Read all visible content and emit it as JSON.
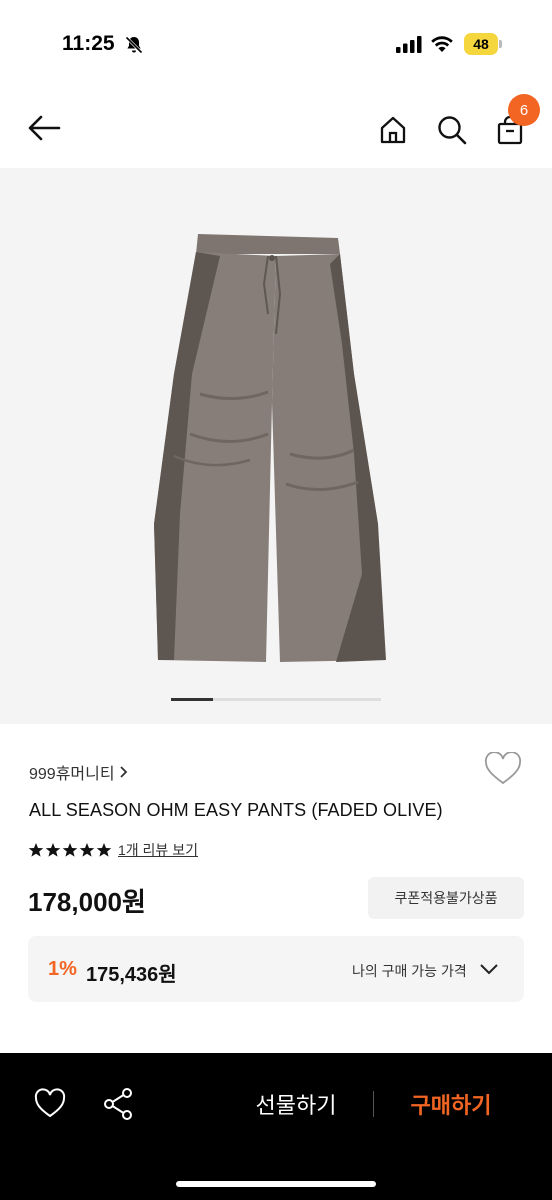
{
  "status": {
    "time": "11:25",
    "battery": "48"
  },
  "nav": {
    "cart_count": "6",
    "icons": [
      "back-arrow-icon",
      "home-icon",
      "search-icon",
      "shopping-bag-icon"
    ]
  },
  "product": {
    "brand": "999휴머니티",
    "title": "ALL SEASON OHM EASY PANTS (FADED OLIVE)",
    "rating_stars": 5,
    "review_link": "1개 리뷰 보기",
    "price": "178,000원",
    "coupon_note": "쿠폰적용불가상품",
    "carousel_progress": 0.2
  },
  "my_price": {
    "discount": "1%",
    "price": "175,436원",
    "label": "나의 구매 가능 가격"
  },
  "bottom_bar": {
    "gift_label": "선물하기",
    "buy_label": "구매하기"
  },
  "colors": {
    "accent": "#f26522",
    "bottom_bar_bg": "#000000"
  }
}
